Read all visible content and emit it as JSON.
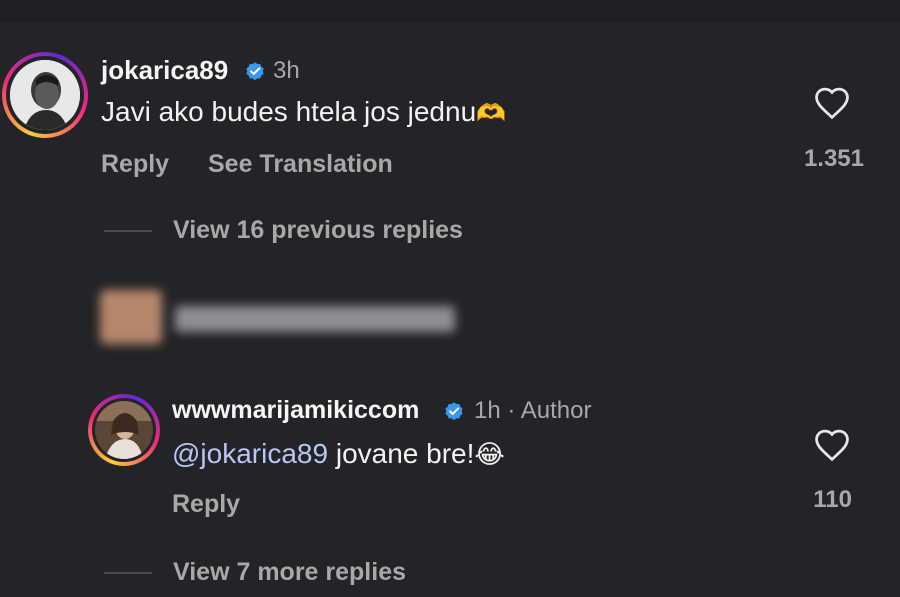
{
  "comments": [
    {
      "username": "jokarica89",
      "time": "3h",
      "text": "Javi ako budes htela jos jednu",
      "emoji": "🫶",
      "actions": {
        "reply": "Reply",
        "see_translation": "See Translation"
      },
      "likes": "1.351",
      "icons": {
        "verified": "verified-badge-icon",
        "like": "heart-icon"
      }
    },
    {
      "username": "wwwmarijamikiccom",
      "time": "1h",
      "separator": "·",
      "author_label": "Author",
      "mention": "@jokarica89",
      "text": " jovane bre!",
      "emoji": "😂",
      "actions": {
        "reply": "Reply"
      },
      "likes": "110"
    }
  ],
  "replies": {
    "previous": "View 16 previous replies",
    "more": "View 7 more replies"
  },
  "colors": {
    "background": "#232427",
    "verified": "#3897f0",
    "mention": "#b7c6f5",
    "secondary_text": "#a8a8a8"
  }
}
